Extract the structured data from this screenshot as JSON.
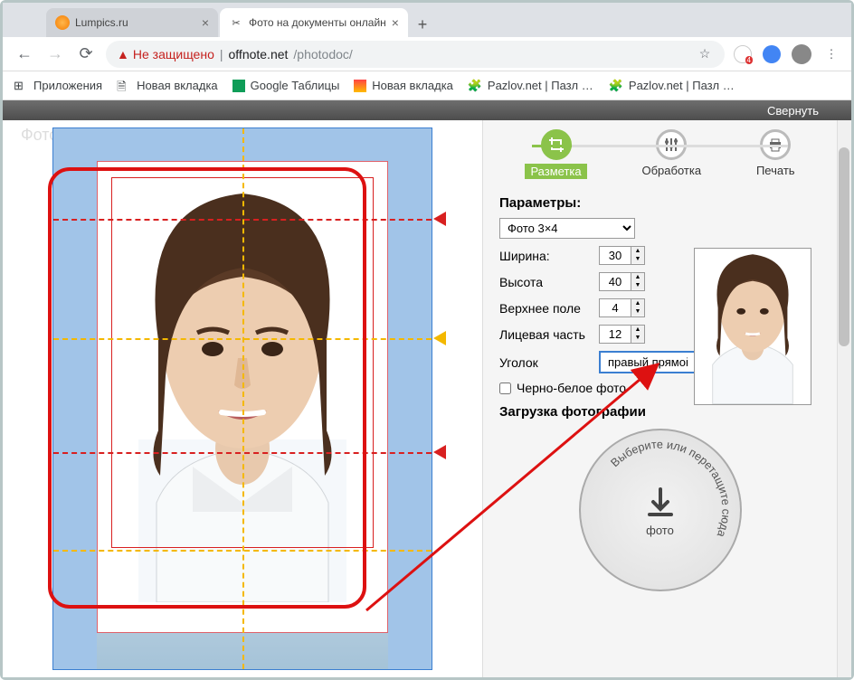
{
  "window": {
    "min": "—",
    "max": "▢",
    "close": "✕"
  },
  "tabs": [
    {
      "label": "Lumpics.ru",
      "active": false
    },
    {
      "label": "Фото на документы онлайн",
      "active": true
    }
  ],
  "addressBar": {
    "notSecure": "Не защищено",
    "host": "offnote.net",
    "path": "/photodoc/"
  },
  "bookmarks": [
    {
      "label": "Приложения"
    },
    {
      "label": "Новая вкладка"
    },
    {
      "label": "Google Таблицы"
    },
    {
      "label": "Новая вкладка"
    },
    {
      "label": "Pazlov.net | Пазл - Со..."
    },
    {
      "label": "Pazlov.net | Пазл - Ка..."
    }
  ],
  "topBar": {
    "collapse": "Свернуть"
  },
  "leftTitle": "Фото на документы",
  "steps": [
    {
      "label": "Разметка",
      "active": true
    },
    {
      "label": "Обработка",
      "active": false
    },
    {
      "label": "Печать",
      "active": false
    }
  ],
  "params": {
    "heading": "Параметры:",
    "preset": "Фото 3×4",
    "widthLabel": "Ширина:",
    "widthValue": "30",
    "heightLabel": "Высота",
    "heightValue": "40",
    "topMarginLabel": "Верхнее поле",
    "topMarginValue": "4",
    "facePartLabel": "Лицевая часть",
    "facePartValue": "12",
    "cornerLabel": "Уголок",
    "cornerValue": "правый прямой",
    "bwLabel": "Черно-белое фото"
  },
  "upload": {
    "heading": "Загрузка фотографии",
    "circleText": "Выберите или перетащите сюда",
    "photoLabel": "фото"
  }
}
